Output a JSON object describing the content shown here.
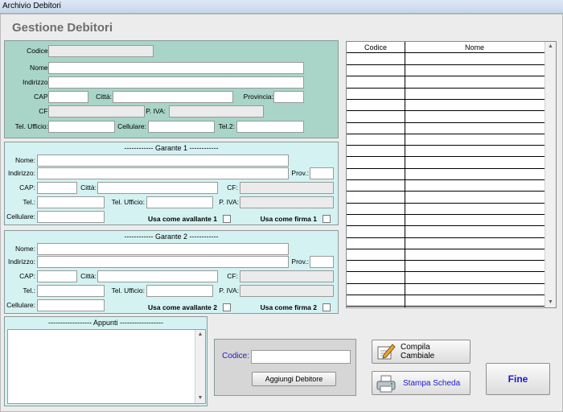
{
  "window": {
    "title": "Archivio Debitori"
  },
  "heading": "Gestione Debitori",
  "debitore": {
    "codice_label": "Codice:",
    "nome_label": "Nome:",
    "indirizzo_label": "Indirizzo:",
    "cap_label": "CAP:",
    "citta_label": "Città:",
    "provincia_label": "Provincia:",
    "cf_label": "CF:",
    "piva_label": "P. IVA:",
    "tel_ufficio_label": "Tel. Ufficio:",
    "cellulare_label": "Cellulare:",
    "tel2_label": "Tel.2:"
  },
  "garante1": {
    "title": "------------ Garante 1 ------------",
    "nome_label": "Nome:",
    "indirizzo_label": "Indirizzo:",
    "prov_label": "Prov.:",
    "cap_label": "CAP:",
    "citta_label": "Città:",
    "cf_label": "CF:",
    "tel_label": "Tel.:",
    "tel_ufficio_label": "Tel. Ufficio:",
    "piva_label": "P. IVA:",
    "cellulare_label": "Cellulare:",
    "avallante_label": "Usa come avallante 1",
    "firma_label": "Usa come firma 1"
  },
  "garante2": {
    "title": "------------ Garante 2 ------------",
    "nome_label": "Nome:",
    "indirizzo_label": "Indirizzo:",
    "prov_label": "Prov.:",
    "cap_label": "CAP:",
    "citta_label": "Città:",
    "cf_label": "CF:",
    "tel_label": "Tel.:",
    "tel_ufficio_label": "Tel. Ufficio:",
    "piva_label": "P. IVA:",
    "cellulare_label": "Cellulare:",
    "avallante_label": "Usa come avallante 2",
    "firma_label": "Usa come firma 2"
  },
  "appunti": {
    "title": "------------------ Appunti ------------------"
  },
  "grid": {
    "columns": [
      "Codice",
      "Nome"
    ]
  },
  "add_panel": {
    "codice_label": "Codice:",
    "add_button": "Aggiungi Debitore"
  },
  "buttons": {
    "compila": "Compila Cambiale",
    "stampa": "Stampa Scheda",
    "fine": "Fine"
  },
  "colors": {
    "main_panel": "#a8d5c8",
    "garante_panel": "#d4f2f2",
    "link_blue": "#1a1acc"
  }
}
